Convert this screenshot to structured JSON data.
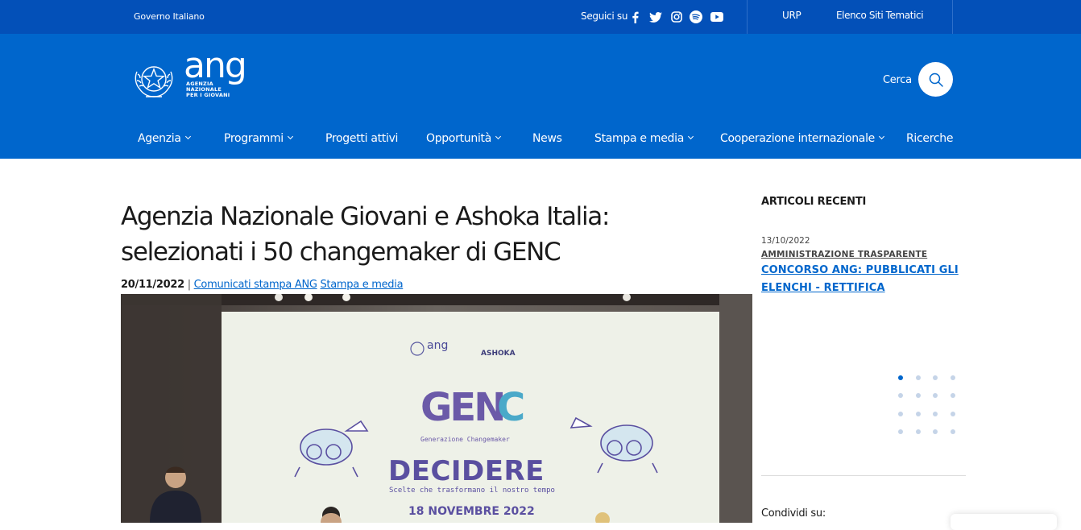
{
  "topbar": {
    "government": "Governo Italiano",
    "follow_us": "Seguici su",
    "social_icons": [
      "facebook-icon",
      "twitter-icon",
      "instagram-icon",
      "spotify-icon",
      "youtube-icon"
    ],
    "urp": "URP",
    "thematic_sites": "Elenco Siti Tematici"
  },
  "header": {
    "logo_word": "ang",
    "logo_sub1": "AGENZIA",
    "logo_sub2": "NAZIONALE",
    "logo_sub3": "PER I GIOVANI",
    "search_label": "Cerca"
  },
  "nav": {
    "items": [
      {
        "label": "Agenzia"
      },
      {
        "label": "Programmi"
      },
      {
        "label": "Progetti attivi"
      },
      {
        "label": "Opportunità"
      },
      {
        "label": "News"
      },
      {
        "label": "Stampa e media"
      },
      {
        "label": "Cooperazione internazionale"
      },
      {
        "label": "Ricerche"
      }
    ]
  },
  "article": {
    "title_line1": "Agenzia Nazionale Giovani e Ashoka Italia:",
    "title_line2": "selezionati i 50 changemaker di GENC",
    "date": "20/11/2022",
    "separator": "|",
    "category1": "Comunicati stampa ANG",
    "category2": "Stampa e media",
    "hero": {
      "ashoka": "ASHOKA",
      "genc_top": "GEN",
      "genc_c": "C",
      "genc_sub": "Generazione Changemaker",
      "decidere": "DECIDERE",
      "decidere_sub": "Scelte che trasformano il nostro tempo",
      "event_date": "18 NOVEMBRE 2022"
    }
  },
  "sidebar": {
    "heading": "ARTICOLI RECENTI",
    "recent": {
      "date": "13/10/2022",
      "category": "AMMINISTRAZIONE TRASPARENTE",
      "title_line1": "CONCORSO ANG: PUBBLICATI GLI",
      "title_line2": "ELENCHI - RETTIFICA"
    },
    "share_label": "Condividi su:"
  },
  "colors": {
    "topbar": "#0350b8",
    "header": "#0066cc",
    "link": "#0066cc"
  }
}
